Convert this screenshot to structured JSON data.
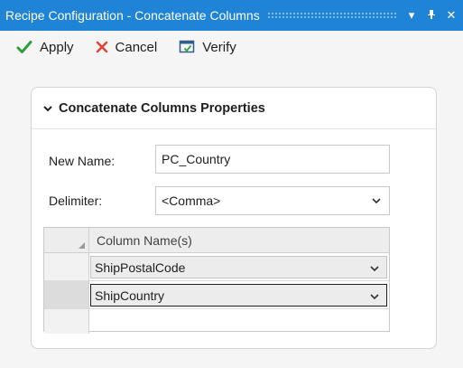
{
  "window": {
    "title": "Recipe Configuration - Concatenate Columns",
    "buttons": {
      "dropdown": "▾",
      "pin": "⊥",
      "close": "✕"
    }
  },
  "toolbar": {
    "apply_label": "Apply",
    "cancel_label": "Cancel",
    "verify_label": "Verify",
    "apply_icon": "check-icon",
    "cancel_icon": "x-icon",
    "verify_icon": "verify-icon",
    "colors": {
      "apply": "#2e9e3a",
      "cancel": "#e0453a",
      "verify": "#2f5d8a"
    }
  },
  "panel": {
    "title": "Concatenate Columns Properties",
    "new_name": {
      "label": "New Name:",
      "value": "PC_Country"
    },
    "delimiter": {
      "label": "Delimiter:",
      "value": "<Comma>"
    },
    "grid": {
      "column_header": "Column Name(s)",
      "rows": [
        {
          "value": "ShipPostalCode",
          "selected": false
        },
        {
          "value": "ShipCountry",
          "selected": true
        }
      ]
    }
  },
  "colors": {
    "titlebar": "#1f83d6",
    "background": "#f5f5f5"
  }
}
